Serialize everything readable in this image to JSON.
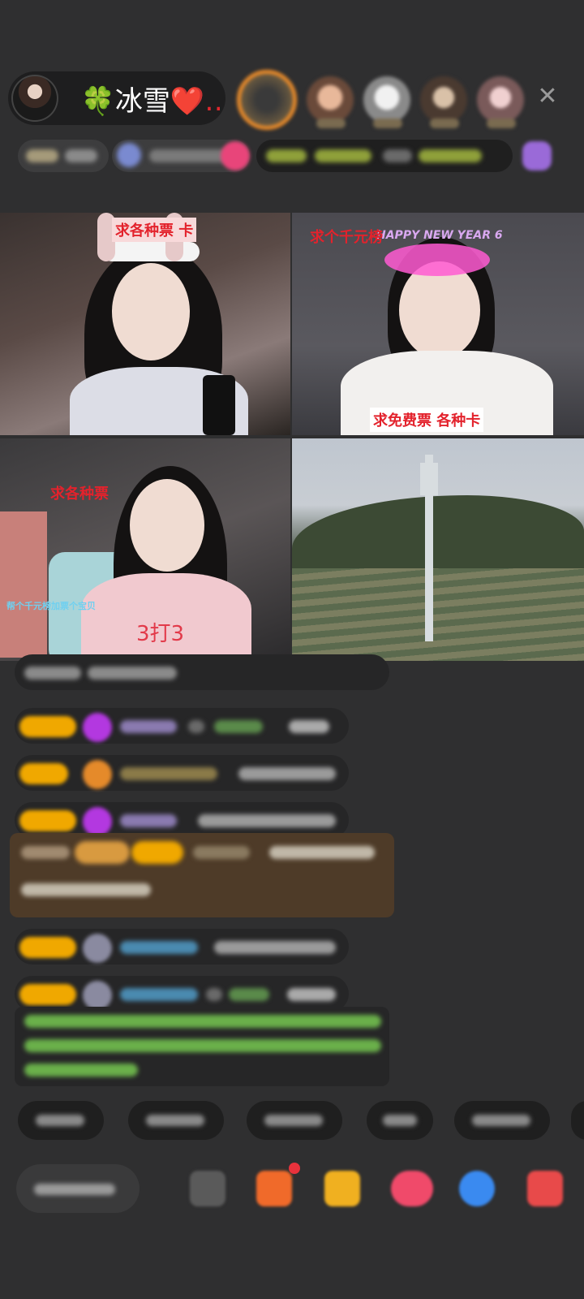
{
  "header": {
    "host_name_prefix": "🍀",
    "host_name": "冰雪",
    "host_name_suffix": "❤️…",
    "close_icon": "close-icon"
  },
  "videos": {
    "top_left_tag": "求各种票 卡",
    "top_right_tag": "求个千元榜",
    "top_right_bottom_tag": "求免费票 各种卡",
    "top_right_neon": "HAPPY NEW YEAR 6",
    "bottom_left_tag": "求各种票",
    "bottom_left_small": "帮个千元榜加票个宝贝",
    "bottom_left_big": "3打3"
  },
  "colors": {
    "background": "#2f2f30",
    "level_badge": "#f0a800",
    "highlight_bg": "#4e3b28",
    "tag_red": "#e3222c"
  }
}
